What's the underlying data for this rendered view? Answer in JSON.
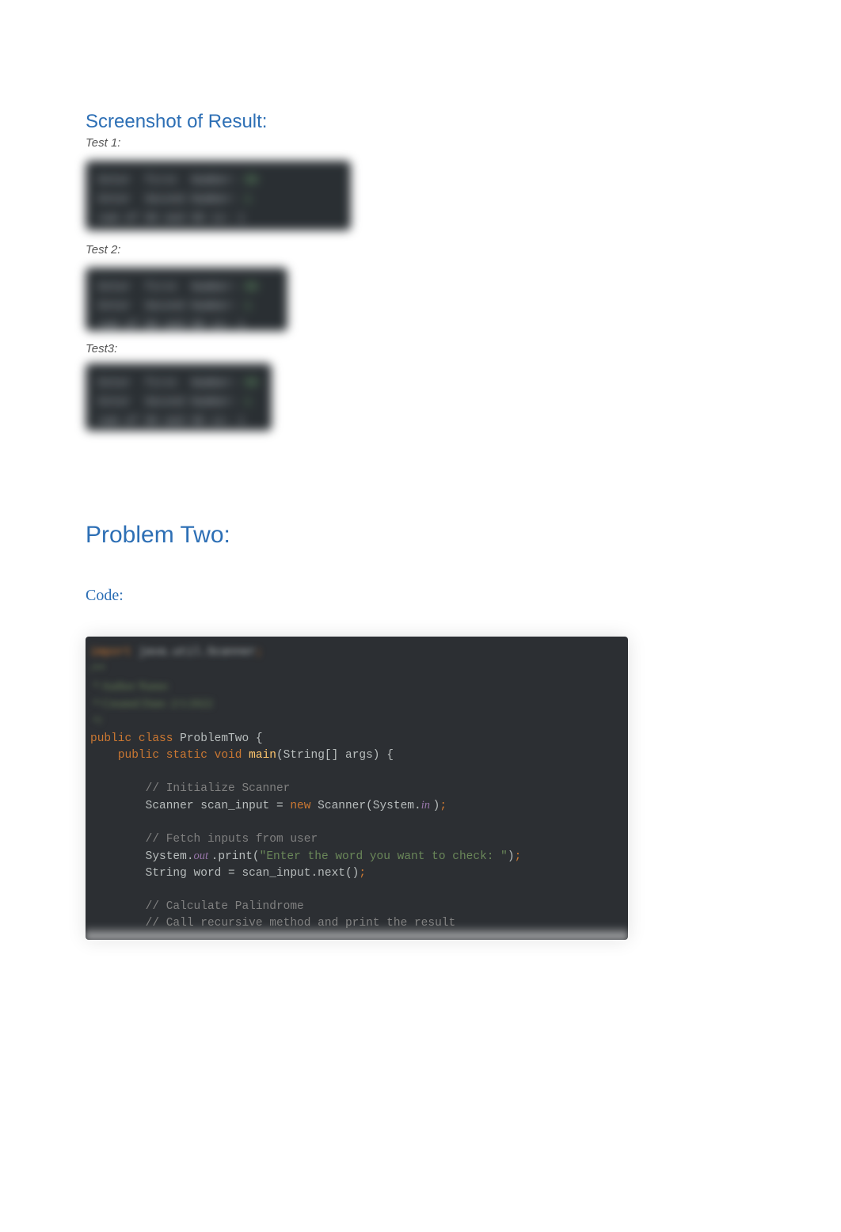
{
  "headings": {
    "result": "Screenshot of Result:",
    "problem": "Problem Two:",
    "code": "Code:"
  },
  "tests": {
    "t1_label": "Test 1:",
    "t2_label": "Test 2:",
    "t3_label": "Test3:"
  },
  "blurred_terminal": {
    "line1a": "Enter  first  Number: ",
    "line1b": "99",
    "line2a": "Enter  Second Number: ",
    "line2b": "1",
    "line3": "sum of 99 and 99 is: 1"
  },
  "code": {
    "import_kw": "import",
    "import_rest": " java.util.Scanner",
    "semi": ";",
    "jdoc_open": "/**",
    "jdoc_author": " * Author Name:",
    "jdoc_date": " * Created Date: 2/1/2022",
    "jdoc_close": " */",
    "public": "public",
    "class": "class",
    "classname": "ProblemTwo",
    "brace_open": "{",
    "static": "static",
    "void": "void",
    "main": "main",
    "main_args": "(String[] args) {",
    "c_init": "// Initialize Scanner",
    "scan_decl_a": "Scanner scan_input = ",
    "new_kw": "new",
    "scan_decl_b": " Scanner(System.",
    "in_kw": "in ",
    "scan_decl_c": ")",
    "c_fetch": "// Fetch inputs from user",
    "sysout_a": "System.",
    "out_kw": "out ",
    "sysout_b": ".print(",
    "prompt_str": "\"Enter the word you want to check: \"",
    "sysout_c": ")",
    "word_line": "String word = scan_input.next()",
    "c_palin": "// Calculate Palindrome",
    "c_recur": "// Call recursive method and print the result"
  }
}
